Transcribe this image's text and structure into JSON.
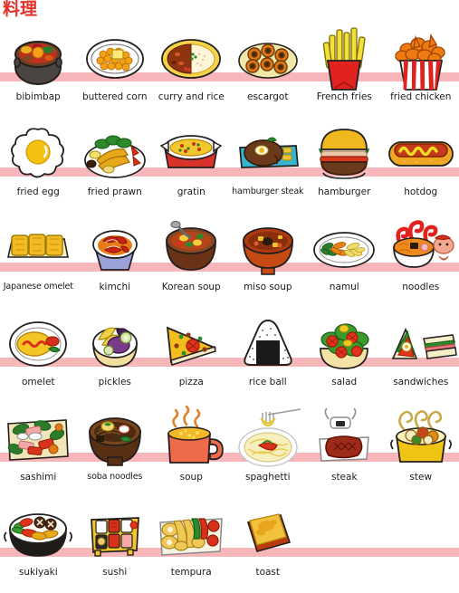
{
  "page": {
    "title": "料理",
    "title_color": "#e43029",
    "band_color": "#f6b6ba",
    "background_color": "#ffffff",
    "label_color": "#1b1b1b",
    "columns": 6,
    "row_count": 6,
    "item_count": 34
  },
  "rows": [
    {
      "index": 1,
      "items": [
        {
          "label": "bibimbap",
          "icon": "bibimbap-icon"
        },
        {
          "label": "buttered corn",
          "icon": "buttered-corn-icon"
        },
        {
          "label": "curry and rice",
          "icon": "curry-and-rice-icon"
        },
        {
          "label": "escargot",
          "icon": "escargot-icon"
        },
        {
          "label": "French fries",
          "icon": "french-fries-icon"
        },
        {
          "label": "fried chicken",
          "icon": "fried-chicken-icon"
        }
      ]
    },
    {
      "index": 2,
      "items": [
        {
          "label": "fried egg",
          "icon": "fried-egg-icon"
        },
        {
          "label": "fried prawn",
          "icon": "fried-prawn-icon"
        },
        {
          "label": "gratin",
          "icon": "gratin-icon"
        },
        {
          "label": "hamburger steak",
          "icon": "hamburger-steak-icon"
        },
        {
          "label": "hamburger",
          "icon": "hamburger-icon"
        },
        {
          "label": "hotdog",
          "icon": "hotdog-icon"
        }
      ]
    },
    {
      "index": 3,
      "items": [
        {
          "label": "Japanese omelet",
          "icon": "japanese-omelet-icon"
        },
        {
          "label": "kimchi",
          "icon": "kimchi-icon"
        },
        {
          "label": "Korean soup",
          "icon": "korean-soup-icon"
        },
        {
          "label": "miso soup",
          "icon": "miso-soup-icon"
        },
        {
          "label": "namul",
          "icon": "namul-icon"
        },
        {
          "label": "noodles",
          "icon": "noodles-icon"
        }
      ]
    },
    {
      "index": 4,
      "items": [
        {
          "label": "omelet",
          "icon": "omelet-icon"
        },
        {
          "label": "pickles",
          "icon": "pickles-icon"
        },
        {
          "label": "pizza",
          "icon": "pizza-icon"
        },
        {
          "label": "rice ball",
          "icon": "rice-ball-icon"
        },
        {
          "label": "salad",
          "icon": "salad-icon"
        },
        {
          "label": "sandwiches",
          "icon": "sandwiches-icon"
        }
      ]
    },
    {
      "index": 5,
      "items": [
        {
          "label": "sashimi",
          "icon": "sashimi-icon"
        },
        {
          "label": "soba noodles",
          "icon": "soba-noodles-icon"
        },
        {
          "label": "soup",
          "icon": "soup-icon"
        },
        {
          "label": "spaghetti",
          "icon": "spaghetti-icon"
        },
        {
          "label": "steak",
          "icon": "steak-icon"
        },
        {
          "label": "stew",
          "icon": "stew-icon"
        }
      ]
    },
    {
      "index": 6,
      "items": [
        {
          "label": "sukiyaki",
          "icon": "sukiyaki-icon"
        },
        {
          "label": "sushi",
          "icon": "sushi-icon"
        },
        {
          "label": "tempura",
          "icon": "tempura-icon"
        },
        {
          "label": "toast",
          "icon": "toast-icon"
        }
      ]
    }
  ]
}
